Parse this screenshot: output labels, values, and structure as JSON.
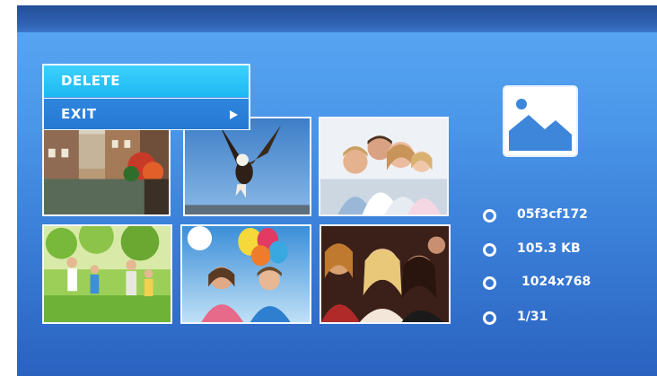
{
  "colors": {
    "accent": "#1bb8f2",
    "background": "#3a7fd8",
    "topbar": "#2a5aa6",
    "text": "#ffffff"
  },
  "menu": {
    "items": [
      {
        "label": "DELETE",
        "selected": true
      },
      {
        "label": "EXIT",
        "has_submenu": true
      }
    ]
  },
  "thumbnails": [
    {
      "name": "canal-houses-photo"
    },
    {
      "name": "eagle-photo"
    },
    {
      "name": "family-portrait-photo"
    },
    {
      "name": "family-running-photo"
    },
    {
      "name": "balloons-kids-photo"
    },
    {
      "name": "party-friends-photo"
    }
  ],
  "preview": {
    "icon": "image-placeholder-icon"
  },
  "info": {
    "file_name": "05f3cf172",
    "file_size": "105.3 KB",
    "resolution": "1024x768",
    "position": "1/31"
  }
}
